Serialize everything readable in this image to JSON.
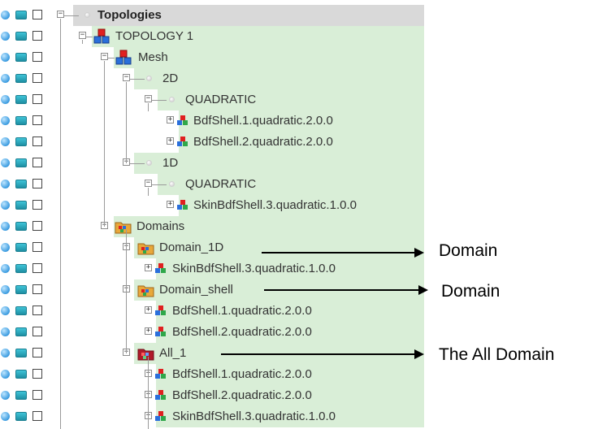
{
  "tree": {
    "root": {
      "label": "Topologies"
    },
    "topology": {
      "label": "TOPOLOGY 1"
    },
    "mesh": {
      "label": "Mesh"
    },
    "mesh_2d": {
      "label": "2D"
    },
    "mesh_2d_quadratic": {
      "label": "QUADRATIC"
    },
    "mesh_2d_items": [
      {
        "label": "BdfShell.1.quadratic.2.0.0"
      },
      {
        "label": "BdfShell.2.quadratic.2.0.0"
      }
    ],
    "mesh_1d": {
      "label": "1D"
    },
    "mesh_1d_quadratic": {
      "label": "QUADRATIC"
    },
    "mesh_1d_items": [
      {
        "label": "SkinBdfShell.3.quadratic.1.0.0"
      }
    ],
    "domains": {
      "label": "Domains"
    },
    "domain_1d": {
      "label": "Domain_1D"
    },
    "domain_1d_items": [
      {
        "label": "SkinBdfShell.3.quadratic.1.0.0"
      }
    ],
    "domain_shell": {
      "label": "Domain_shell"
    },
    "domain_shell_items": [
      {
        "label": "BdfShell.1.quadratic.2.0.0"
      },
      {
        "label": "BdfShell.2.quadratic.2.0.0"
      }
    ],
    "all_1": {
      "label": "All_1"
    },
    "all_1_items": [
      {
        "label": "BdfShell.1.quadratic.2.0.0"
      },
      {
        "label": "BdfShell.2.quadratic.2.0.0"
      },
      {
        "label": "SkinBdfShell.3.quadratic.1.0.0"
      }
    ]
  },
  "annotations": [
    {
      "text": "Domain"
    },
    {
      "text": "Domain"
    },
    {
      "text": "The All Domain"
    }
  ],
  "colors": {
    "row_highlight": "#d9eed7",
    "selected_row": "#d9d9d9"
  }
}
